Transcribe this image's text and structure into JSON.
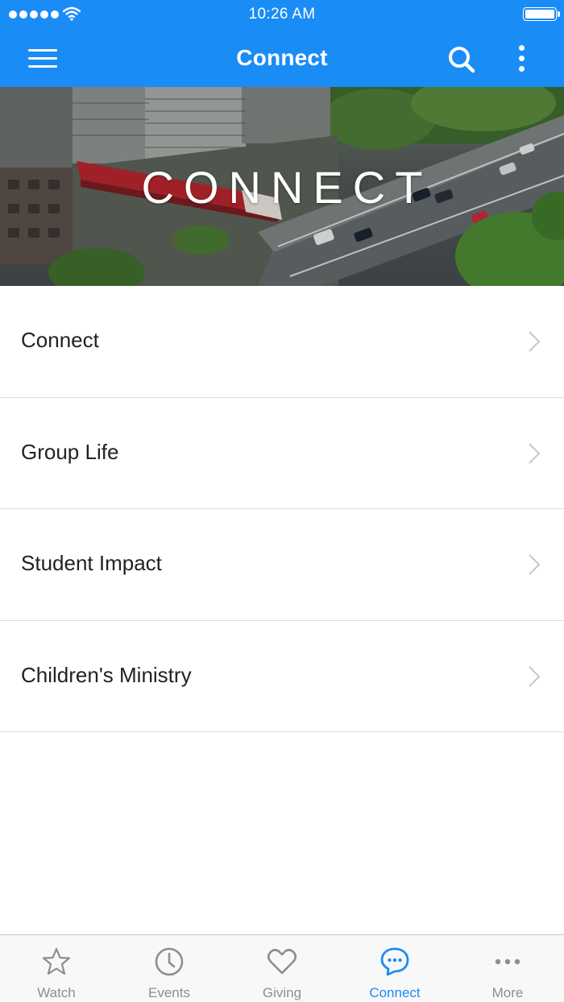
{
  "status_bar": {
    "time": "10:26 AM"
  },
  "nav": {
    "title": "Connect",
    "menu_icon": "hamburger-menu-icon",
    "search_icon": "search-icon",
    "more_icon": "vertical-dots-icon"
  },
  "hero": {
    "title": "CONNECT"
  },
  "list": {
    "items": [
      {
        "label": "Connect"
      },
      {
        "label": "Group Life"
      },
      {
        "label": "Student Impact"
      },
      {
        "label": "Children's Ministry"
      }
    ]
  },
  "tabbar": {
    "tabs": [
      {
        "label": "Watch",
        "icon": "star-icon",
        "active": false
      },
      {
        "label": "Events",
        "icon": "clock-icon",
        "active": false
      },
      {
        "label": "Giving",
        "icon": "heart-icon",
        "active": false
      },
      {
        "label": "Connect",
        "icon": "chat-bubble-icon",
        "active": true
      },
      {
        "label": "More",
        "icon": "horizontal-dots-icon",
        "active": false
      }
    ]
  },
  "colors": {
    "accent": "#1a8cf6",
    "inactive_tab": "#8e8e8e",
    "text": "#222222",
    "divider": "#dcdcdc"
  }
}
